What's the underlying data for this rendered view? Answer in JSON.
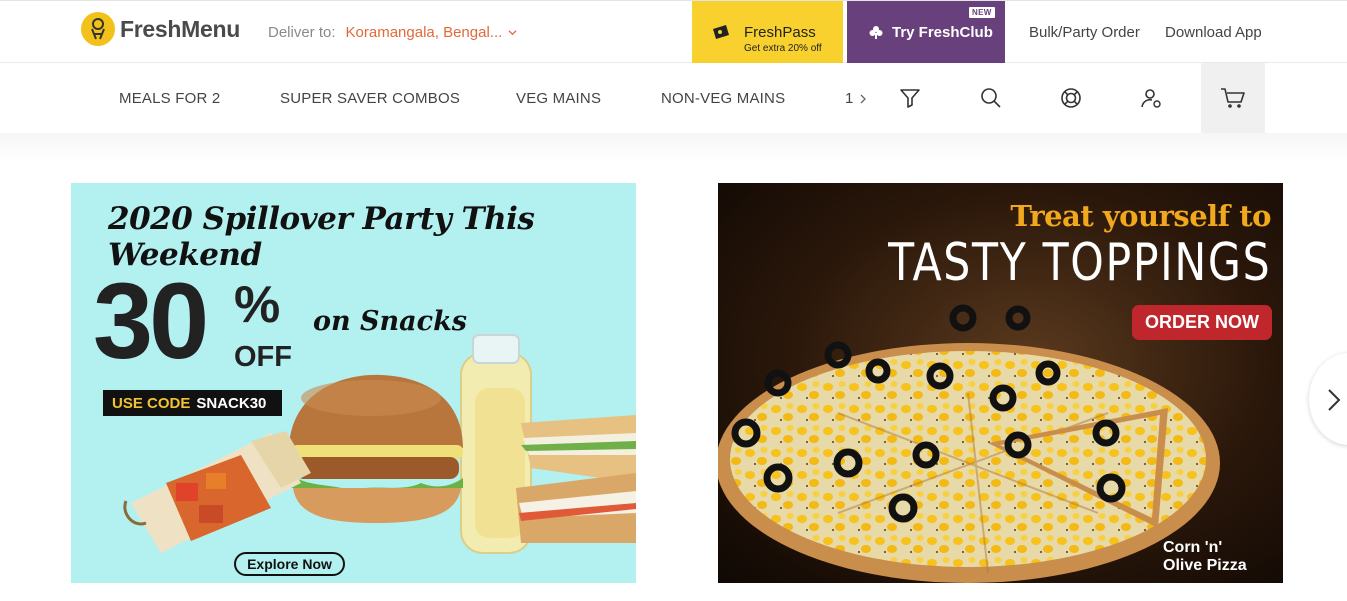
{
  "header": {
    "brand": "FreshMenu",
    "deliver_label": "Deliver to:",
    "deliver_location": "Koramangala, Bengal...",
    "freshpass": {
      "title": "FreshPass",
      "subtitle": "Get extra 20% off"
    },
    "freshclub": {
      "title": "Try FreshClub",
      "badge": "NEW"
    },
    "links": {
      "bulk": "Bulk/Party Order",
      "download": "Download App"
    }
  },
  "nav": {
    "items": [
      "MEALS FOR 2",
      "SUPER SAVER COMBOS",
      "VEG MAINS",
      "NON-VEG MAINS"
    ],
    "more": "1",
    "icons": [
      "filter-icon",
      "search-icon",
      "help-icon",
      "user-icon",
      "cart-icon"
    ]
  },
  "banners": {
    "left": {
      "title": "2020 Spillover Party This Weekend",
      "discount_number": "30",
      "discount_percent": "%",
      "discount_off": "OFF",
      "tagline": "on Snacks",
      "code_label": "USE CODE",
      "code_value": "SNACK30",
      "cta": "Explore Now"
    },
    "right": {
      "title_line1": "Treat yourself to",
      "title_line2": "TASTY TOPPINGS",
      "cta": "ORDER NOW",
      "caption_line1": "Corn 'n'",
      "caption_line2": "Olive Pizza"
    }
  },
  "colors": {
    "brand_yellow": "#f8d12f",
    "club_purple": "#68407c",
    "location_orange": "#e2693a",
    "banner_cyan": "#b3f0f0",
    "order_red": "#c0272d",
    "title_gold": "#f2a81c"
  }
}
